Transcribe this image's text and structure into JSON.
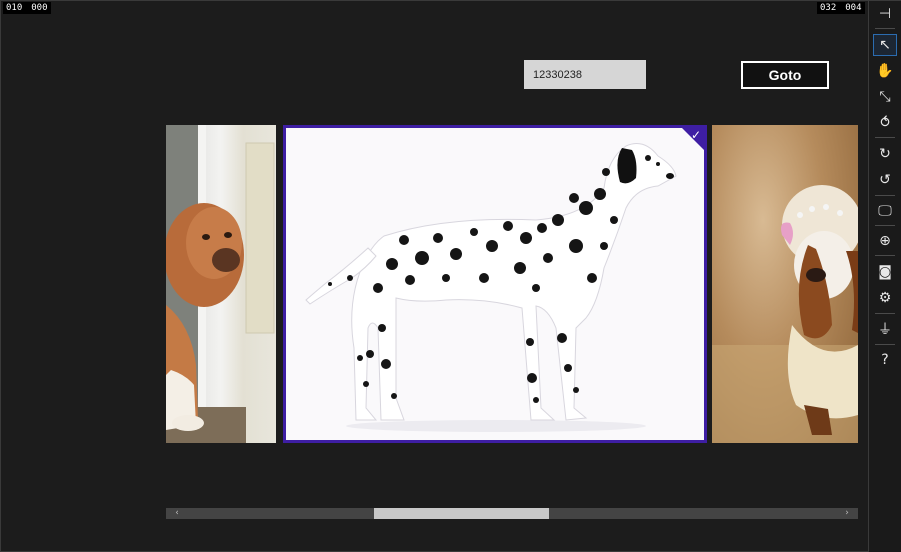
{
  "counters": {
    "left": [
      "010",
      "000"
    ],
    "right": [
      "032",
      "004"
    ]
  },
  "search": {
    "value": "12330238"
  },
  "goto_button": {
    "label": "Goto"
  },
  "carousel": {
    "left_photo_caption": "",
    "selected_check": "✓"
  },
  "scrollbar": {
    "left_arrow": "‹",
    "right_arrow": "›",
    "thumb_position_fraction": 0.33,
    "thumb_size_fraction": 0.25
  },
  "toolbar": {
    "items": [
      {
        "name": "pin-icon",
        "glyph": "⊣"
      },
      {
        "name": "pointer-icon",
        "glyph": "↖",
        "active": true
      },
      {
        "name": "hand-icon",
        "glyph": "✋"
      },
      {
        "name": "pinch-icon",
        "glyph": "⤡"
      },
      {
        "name": "swipe-icon",
        "glyph": "⥀"
      },
      {
        "name": "rotate-cw-icon",
        "glyph": "↻"
      },
      {
        "name": "rotate-ccw-icon",
        "glyph": "↺"
      },
      {
        "name": "monitor-icon",
        "glyph": "🖵"
      },
      {
        "name": "globe-icon",
        "glyph": "⊕"
      },
      {
        "name": "camera-icon",
        "glyph": "◙"
      },
      {
        "name": "gear-icon",
        "glyph": "⚙"
      },
      {
        "name": "network-icon",
        "glyph": "⏚"
      },
      {
        "name": "help-icon",
        "glyph": "?"
      }
    ]
  }
}
